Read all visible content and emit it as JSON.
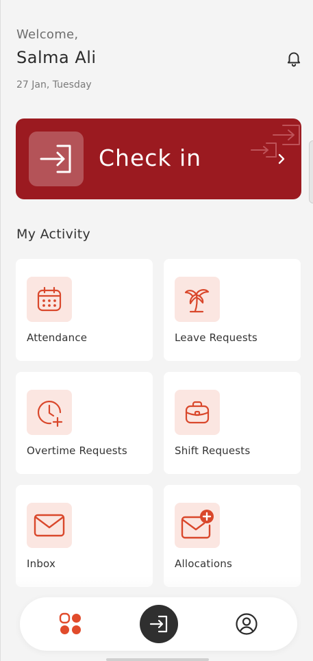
{
  "header": {
    "welcome": "Welcome,",
    "name": "Salma Ali",
    "date": "27 Jan, Tuesday",
    "notification_icon": "bell-icon"
  },
  "checkin": {
    "label": "Check in",
    "icon": "sign-in-icon",
    "background_color": "#9b1a20"
  },
  "activity": {
    "title": "My Activity",
    "items": [
      {
        "label": "Attendance",
        "icon": "calendar-icon"
      },
      {
        "label": "Leave Requests",
        "icon": "palm-tree-icon"
      },
      {
        "label": "Overtime Requests",
        "icon": "clock-plus-icon"
      },
      {
        "label": "Shift Requests",
        "icon": "briefcase-icon"
      },
      {
        "label": "Inbox",
        "icon": "mail-icon"
      },
      {
        "label": "Allocations",
        "icon": "mail-plus-icon"
      }
    ],
    "icon_color": "#d9472b",
    "icon_bg": "#fbe6e1"
  },
  "nav": {
    "home_icon": "grid-icon",
    "center_icon": "sign-in-icon",
    "profile_icon": "user-circle-icon",
    "active_color": "#e14b2b"
  }
}
